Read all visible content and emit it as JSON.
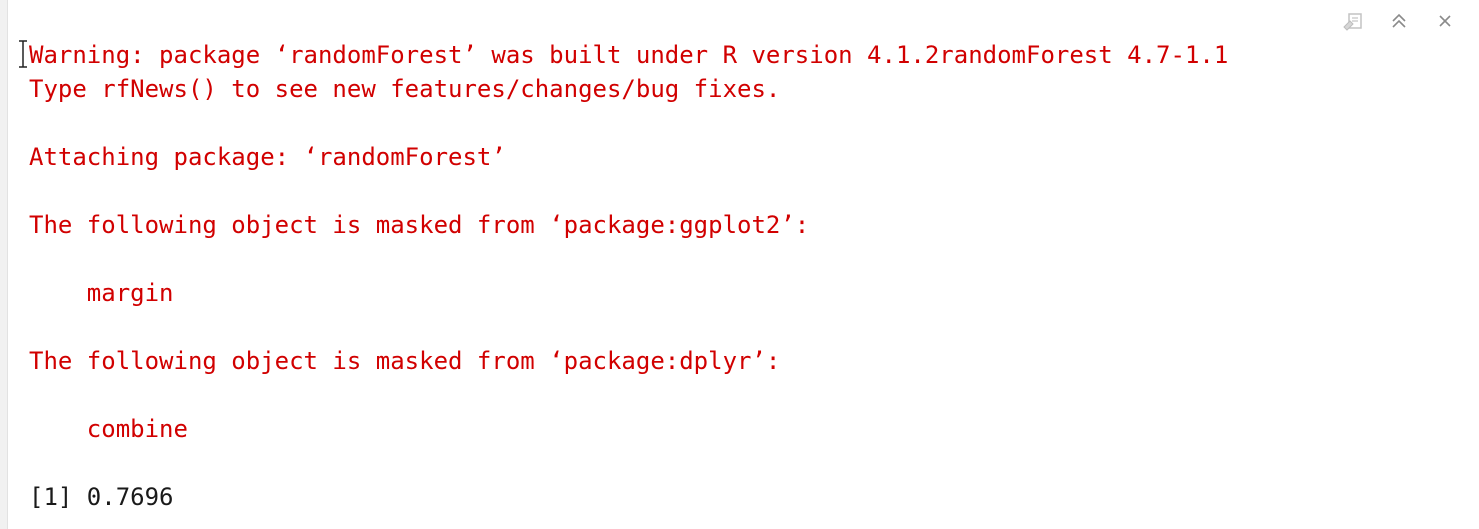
{
  "toolbar": {
    "icons": [
      "clear-console-icon",
      "maximize-icon",
      "close-icon"
    ]
  },
  "console": {
    "lines": [
      {
        "text": "Warning: package ‘randomForest’ was built under R version 4.1.2randomForest 4.7-1.1",
        "color": "#d10000"
      },
      {
        "text": "Type rfNews() to see new features/changes/bug fixes.",
        "color": "#d10000"
      },
      {
        "text": "",
        "color": "#d10000"
      },
      {
        "text": "Attaching package: ‘randomForest’",
        "color": "#d10000"
      },
      {
        "text": "",
        "color": "#d10000"
      },
      {
        "text": "The following object is masked from ‘package:ggplot2’:",
        "color": "#d10000"
      },
      {
        "text": "",
        "color": "#d10000"
      },
      {
        "text": "    margin",
        "color": "#d10000"
      },
      {
        "text": "",
        "color": "#d10000"
      },
      {
        "text": "The following object is masked from ‘package:dplyr’:",
        "color": "#d10000"
      },
      {
        "text": "",
        "color": "#d10000"
      },
      {
        "text": "    combine",
        "color": "#d10000"
      },
      {
        "text": "",
        "color": "#d10000"
      },
      {
        "text": "[1] 0.7696",
        "color": "#1a1a1a"
      }
    ]
  }
}
